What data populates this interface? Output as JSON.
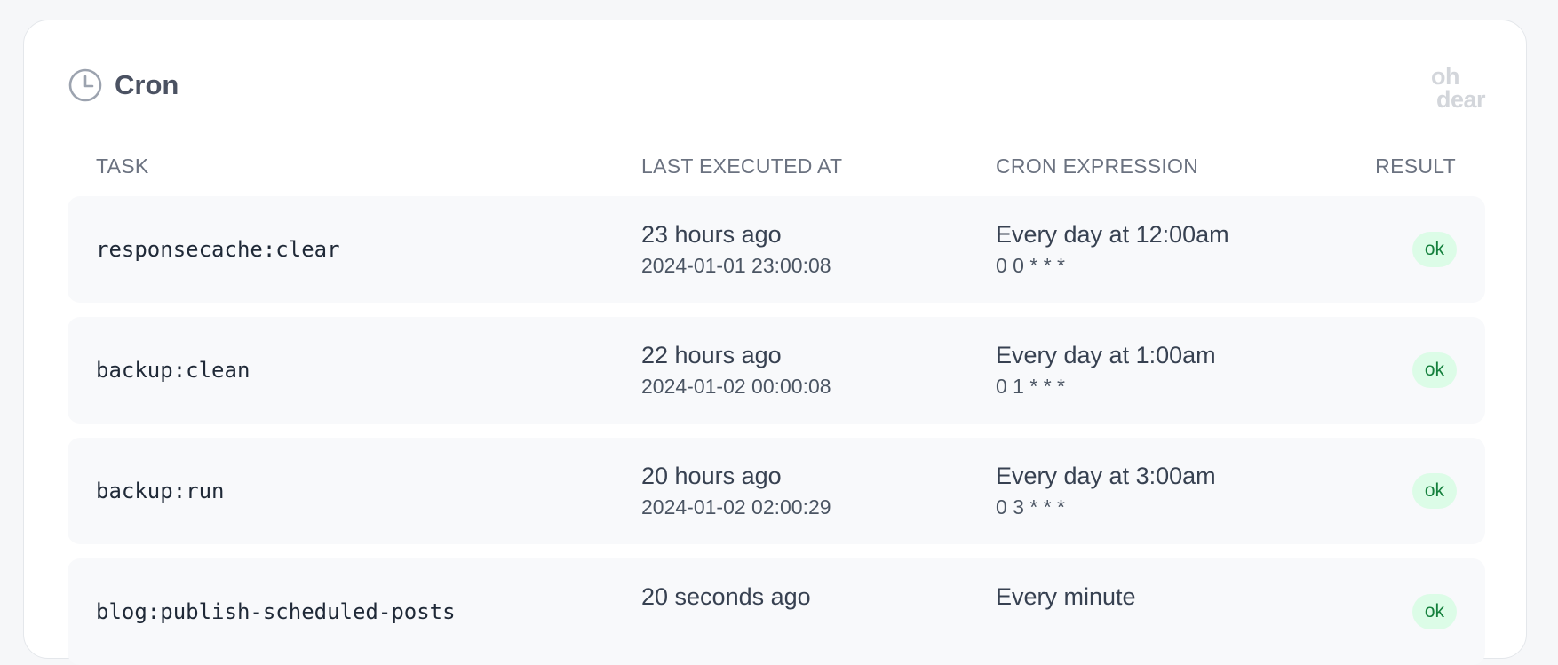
{
  "panel": {
    "title": "Cron",
    "icon": "clock-icon",
    "brand": {
      "line1": "oh",
      "line2": "dear"
    }
  },
  "columns": {
    "task": "TASK",
    "last_executed": "LAST EXECUTED AT",
    "cron_expression": "CRON EXPRESSION",
    "result": "RESULT"
  },
  "rows": [
    {
      "task": "responsecache:clear",
      "last_relative": "23 hours ago",
      "last_timestamp": "2024-01-01 23:00:08",
      "cron_human": "Every day at 12:00am",
      "cron_expr": "0 0 * * *",
      "result": "ok"
    },
    {
      "task": "backup:clean",
      "last_relative": "22 hours ago",
      "last_timestamp": "2024-01-02 00:00:08",
      "cron_human": "Every day at 1:00am",
      "cron_expr": "0 1 * * *",
      "result": "ok"
    },
    {
      "task": "backup:run",
      "last_relative": "20 hours ago",
      "last_timestamp": "2024-01-02 02:00:29",
      "cron_human": "Every day at 3:00am",
      "cron_expr": "0 3 * * *",
      "result": "ok"
    },
    {
      "task": "blog:publish-scheduled-posts",
      "last_relative": "20 seconds ago",
      "last_timestamp": "",
      "cron_human": "Every minute",
      "cron_expr": "",
      "result": "ok"
    }
  ],
  "colors": {
    "ok_badge_bg": "#dcfce7",
    "ok_badge_text": "#15803d"
  }
}
